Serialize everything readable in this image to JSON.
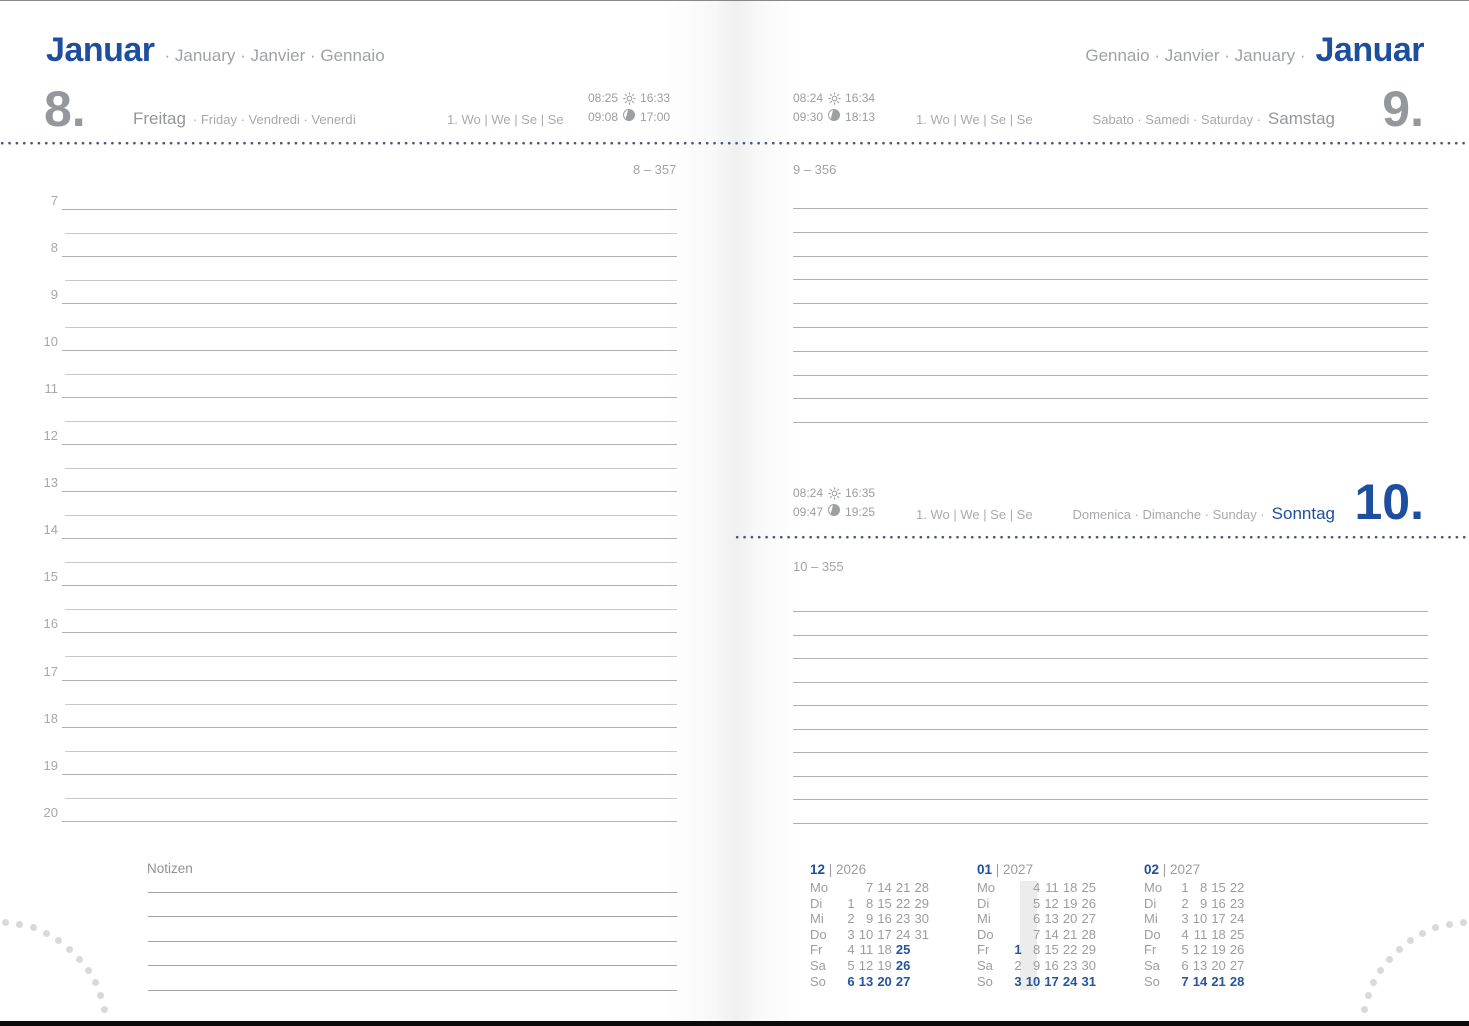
{
  "colors": {
    "accent": "#1d4f9e",
    "day_number_gray": "#94979b",
    "rule_dot_navy": "#4a5670"
  },
  "left_page": {
    "month_primary": "Januar",
    "month_secondary": "· January · Janvier · Gennaio",
    "day_number": "8.",
    "day_name_primary": "Freitag",
    "day_name_secondary": "· Friday · Vendredi · Venerdì",
    "week_info": "1. Wo | We | Se | Se",
    "sun": {
      "rise": "08:25",
      "set": "16:33"
    },
    "moon": {
      "rise": "09:08",
      "set": "17:00"
    },
    "day_counter": "8 – 357",
    "hours": [
      "7",
      "8",
      "9",
      "10",
      "11",
      "12",
      "13",
      "14",
      "15",
      "16",
      "17",
      "18",
      "19",
      "20"
    ]
  },
  "right_page": {
    "saturday": {
      "month_secondary": "Gennaio · Janvier · January ·",
      "month_primary": "Januar",
      "day_number": "9.",
      "day_name_secondary": "Sabato · Samedi · Saturday ·",
      "day_name_primary": "Samstag",
      "week_info": "1. Wo | We | Se | Se",
      "sun": {
        "rise": "08:24",
        "set": "16:34"
      },
      "moon": {
        "rise": "09:30",
        "set": "18:13"
      },
      "day_counter": "9 – 356",
      "ruled_lines": 10
    },
    "sunday": {
      "day_number": "10.",
      "day_name_secondary": "Domenica · Dimanche · Sunday ·",
      "day_name_primary": "Sonntag",
      "week_info": "1. Wo | We | Se | Se",
      "sun": {
        "rise": "08:24",
        "set": "16:35"
      },
      "moon": {
        "rise": "09:47",
        "set": "19:25"
      },
      "day_counter": "10 – 355",
      "ruled_lines": 10
    }
  },
  "notes": {
    "label": "Notizen",
    "ruled_lines": 5
  },
  "mini_calendars": [
    {
      "month": "12",
      "year": "2026",
      "day_labels": [
        "Mo",
        "Di",
        "Mi",
        "Do",
        "Fr",
        "Sa",
        "So"
      ],
      "rows": [
        [
          "",
          "7",
          "14",
          "21",
          "28"
        ],
        [
          "1",
          "8",
          "15",
          "22",
          "29"
        ],
        [
          "2",
          "9",
          "16",
          "23",
          "30"
        ],
        [
          "3",
          "10",
          "17",
          "24",
          "31"
        ],
        [
          "4",
          "11",
          "18",
          "25",
          ""
        ],
        [
          "5",
          "12",
          "19",
          "26",
          ""
        ],
        [
          "6",
          "13",
          "20",
          "27",
          ""
        ]
      ],
      "bold_cells": [
        [
          4,
          3
        ],
        [
          5,
          3
        ],
        [
          6,
          0
        ],
        [
          6,
          1
        ],
        [
          6,
          2
        ],
        [
          6,
          3
        ]
      ],
      "highlight_column": null
    },
    {
      "month": "01",
      "year": "2027",
      "day_labels": [
        "Mo",
        "Di",
        "Mi",
        "Do",
        "Fr",
        "Sa",
        "So"
      ],
      "rows": [
        [
          "",
          "4",
          "11",
          "18",
          "25"
        ],
        [
          "",
          "5",
          "12",
          "19",
          "26"
        ],
        [
          "",
          "6",
          "13",
          "20",
          "27"
        ],
        [
          "",
          "7",
          "14",
          "21",
          "28"
        ],
        [
          "1",
          "8",
          "15",
          "22",
          "29"
        ],
        [
          "2",
          "9",
          "16",
          "23",
          "30"
        ],
        [
          "3",
          "10",
          "17",
          "24",
          "31"
        ]
      ],
      "bold_cells": [
        [
          4,
          0
        ],
        [
          6,
          0
        ],
        [
          6,
          1
        ],
        [
          6,
          2
        ],
        [
          6,
          3
        ],
        [
          6,
          4
        ]
      ],
      "highlight_column": 1
    },
    {
      "month": "02",
      "year": "2027",
      "day_labels": [
        "Mo",
        "Di",
        "Mi",
        "Do",
        "Fr",
        "Sa",
        "So"
      ],
      "rows": [
        [
          "1",
          "8",
          "15",
          "22",
          ""
        ],
        [
          "2",
          "9",
          "16",
          "23",
          ""
        ],
        [
          "3",
          "10",
          "17",
          "24",
          ""
        ],
        [
          "4",
          "11",
          "18",
          "25",
          ""
        ],
        [
          "5",
          "12",
          "19",
          "26",
          ""
        ],
        [
          "6",
          "13",
          "20",
          "27",
          ""
        ],
        [
          "7",
          "14",
          "21",
          "28",
          ""
        ]
      ],
      "bold_cells": [
        [
          6,
          0
        ],
        [
          6,
          1
        ],
        [
          6,
          2
        ],
        [
          6,
          3
        ]
      ],
      "highlight_column": null
    }
  ]
}
